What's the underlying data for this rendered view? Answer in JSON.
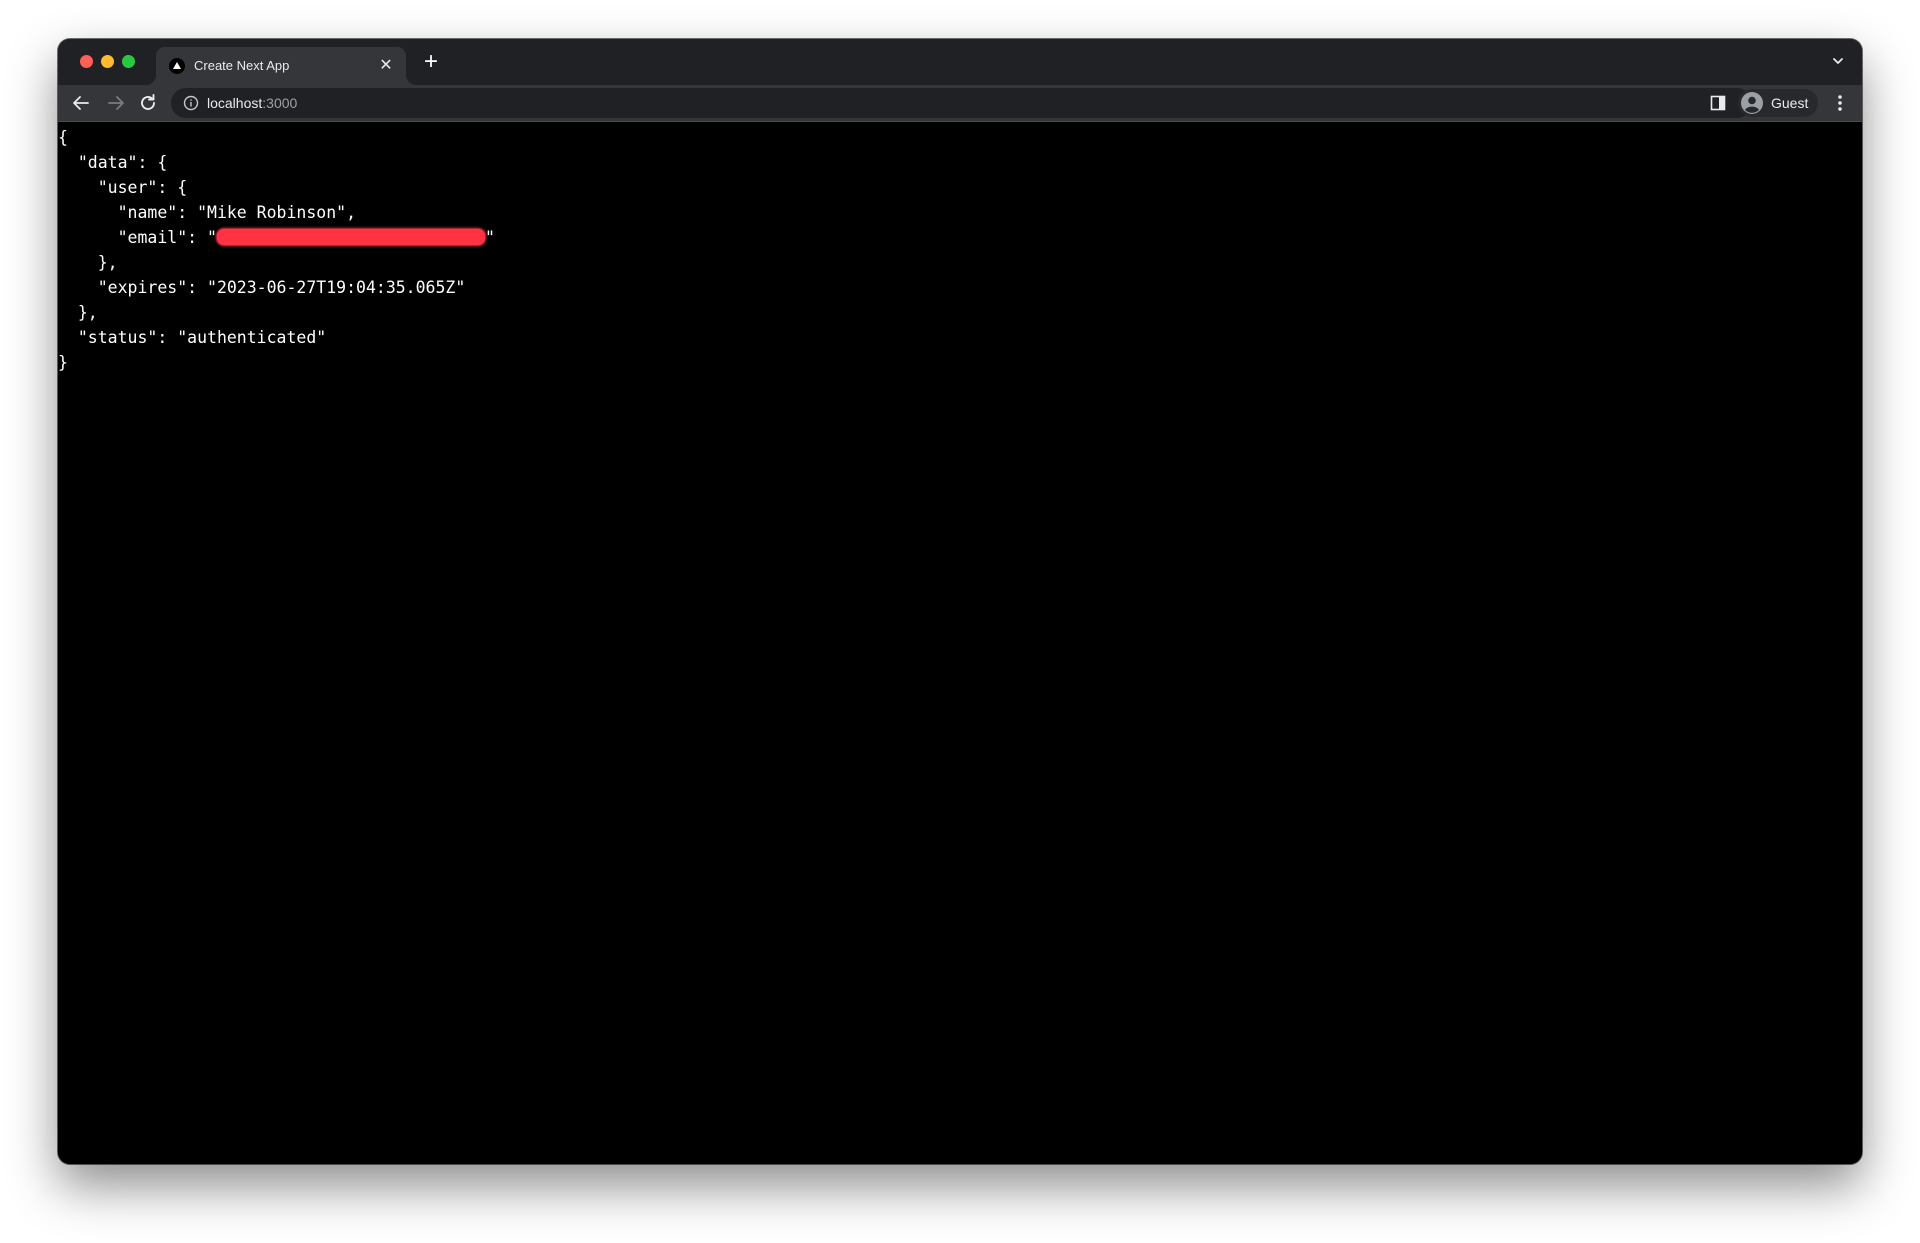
{
  "browser": {
    "tab": {
      "title": "Create Next App",
      "favicon": "nextjs-triangle-icon",
      "close_icon": "close-icon"
    },
    "new_tab_icon": "plus-icon",
    "tab_search_icon": "chevron-down-icon",
    "nav": {
      "back_icon": "arrow-left-icon",
      "forward_icon": "arrow-right-icon",
      "reload_icon": "reload-icon"
    },
    "address_bar": {
      "security_icon": "info-icon",
      "host": "localhost",
      "port": ":3000"
    },
    "side_panel_icon": "side-panel-icon",
    "profile": {
      "avatar_icon": "person-icon",
      "label": "Guest"
    },
    "menu_icon": "more-vertical-icon"
  },
  "page": {
    "lines": {
      "l1": "{",
      "l2": "  \"data\": {",
      "l3": "    \"user\": {",
      "l4": "      \"name\": \"Mike Robinson\",",
      "l5_prefix": "      \"email\": \"",
      "l5_suffix": "\"",
      "l6": "    },",
      "l7": "    \"expires\": \"2023-06-27T19:04:35.065Z\"",
      "l8": "  },",
      "l9": "  \"status\": \"authenticated\"",
      "l10": "}"
    },
    "email_redacted": true
  },
  "colors": {
    "tabstrip": "#202124",
    "toolbar": "#35363a",
    "omnibox": "#202124",
    "content_bg": "#000000",
    "text": "#ffffff",
    "redaction": "#ff3344"
  }
}
